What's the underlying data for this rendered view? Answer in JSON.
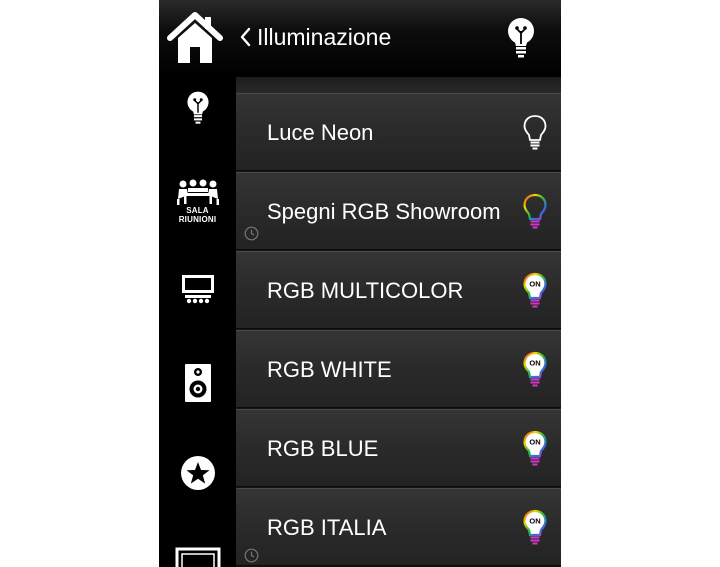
{
  "header": {
    "back_label": "Illuminazione",
    "home_icon": "home-icon",
    "right_icon": "lightbulb-icon"
  },
  "sidebar": {
    "items": [
      {
        "icon": "lightbulb-icon"
      },
      {
        "icon": "meeting-room-icon",
        "label_line1": "SALA",
        "label_line2": "RIUNIONI"
      },
      {
        "icon": "projector-screen-icon"
      },
      {
        "icon": "speaker-icon"
      },
      {
        "icon": "star-icon"
      },
      {
        "icon": "monitor-icon"
      }
    ]
  },
  "list": {
    "items": [
      {
        "label": "Luce Neon",
        "icon": "bulb-outline-icon",
        "scheduled": false
      },
      {
        "label": "Spegni RGB Showroom",
        "icon": "rgb-bulb-icon",
        "scheduled": true
      },
      {
        "label": "RGB MULTICOLOR",
        "icon": "rgb-bulb-on-icon",
        "badge": "ON",
        "scheduled": false
      },
      {
        "label": "RGB WHITE",
        "icon": "rgb-bulb-on-icon",
        "badge": "ON",
        "scheduled": false
      },
      {
        "label": "RGB BLUE",
        "icon": "rgb-bulb-on-icon",
        "badge": "ON",
        "scheduled": false
      },
      {
        "label": "RGB ITALIA",
        "icon": "rgb-bulb-on-icon",
        "badge": "ON",
        "scheduled": true
      }
    ]
  },
  "colors": {
    "background": "#000000",
    "row": "#2b2b2b",
    "text": "#ffffff",
    "rgb_red": "#e8312b",
    "rgb_yellow": "#f2d400",
    "rgb_green": "#2fbf3a",
    "rgb_blue": "#2e6de0",
    "rgb_magenta": "#d238c8"
  }
}
